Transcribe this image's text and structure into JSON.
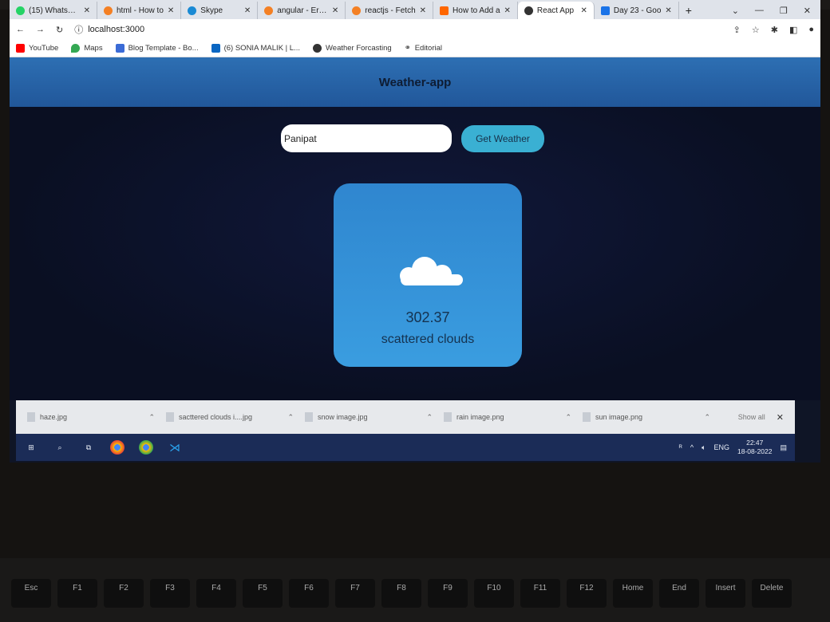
{
  "browser": {
    "tabs": [
      {
        "title": "(15) WhatsApp",
        "color": "#25d366"
      },
      {
        "title": "html - How to",
        "color": "#f48024"
      },
      {
        "title": "Skype",
        "color": "#1a8ad4"
      },
      {
        "title": "angular - Error",
        "color": "#f48024"
      },
      {
        "title": "reactjs - Fetch",
        "color": "#f48024"
      },
      {
        "title": "How to Add a",
        "color": "#ff6600"
      },
      {
        "title": "React App",
        "color": "#333333"
      },
      {
        "title": "Day 23 - Goo",
        "color": "#1a73e8"
      }
    ],
    "active_tab_index": 6,
    "new_tab": "+",
    "url": "localhost:3000",
    "bookmarks": [
      {
        "label": "YouTube",
        "color": "#ff0000"
      },
      {
        "label": "Maps",
        "color": "#34a853"
      },
      {
        "label": "Blog Template - Bo...",
        "color": "#3b6bd6"
      },
      {
        "label": "(6) SONIA MALIK | L...",
        "color": "#0a66c2"
      },
      {
        "label": "Weather Forcasting",
        "color": "#333333"
      },
      {
        "label": "Editorial",
        "color": "#333333"
      }
    ]
  },
  "app": {
    "title": "Weather-app",
    "search_value": "Panipat",
    "button_label": "Get Weather",
    "temperature": "302.37",
    "condition": "scattered clouds",
    "icon": "cloud-icon"
  },
  "downloads": {
    "items": [
      "haze.jpg",
      "sacttered clouds i....jpg",
      "snow image.jpg",
      "rain image.png",
      "sun image.png"
    ],
    "show_all": "Show all"
  },
  "taskbar": {
    "language": "ENG",
    "time": "22:47",
    "date": "18-08-2022"
  },
  "keyboard": {
    "keys": [
      "Esc",
      "F1",
      "F2",
      "F3",
      "F4",
      "F5",
      "F6",
      "F7",
      "F8",
      "F9",
      "F10",
      "F11",
      "F12",
      "Home",
      "End",
      "Insert",
      "Delete"
    ]
  }
}
